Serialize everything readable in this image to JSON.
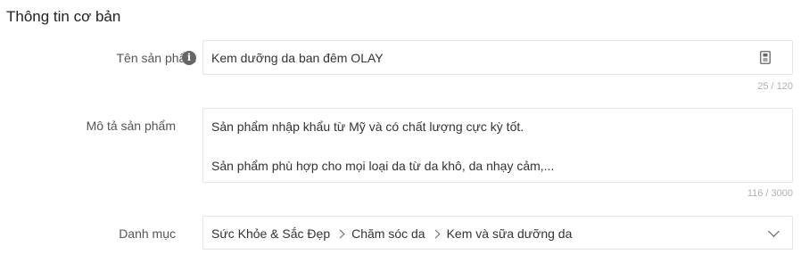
{
  "section": {
    "title": "Thông tin cơ bản"
  },
  "product_name": {
    "label": "Tên sản phẩm",
    "info_icon": "info-icon",
    "value": "Kem dưỡng da ban đêm OLAY",
    "field_icon": "document-icon",
    "counter": "25 / 120"
  },
  "description": {
    "label": "Mô tả sản phẩm",
    "lines": [
      "Sản phẩm nhập khẩu từ Mỹ và có chất lượng cực kỳ tốt.",
      "Sản phẩm phù hợp cho mọi loại da từ da khô, da nhạy cảm,..."
    ],
    "counter": "116 / 3000"
  },
  "category": {
    "label": "Danh mục",
    "path": [
      "Sức Khỏe & Sắc Đẹp",
      "Chăm sóc da",
      "Kem và sữa dưỡng da"
    ],
    "dropdown_icon": "chevron-down-icon"
  }
}
